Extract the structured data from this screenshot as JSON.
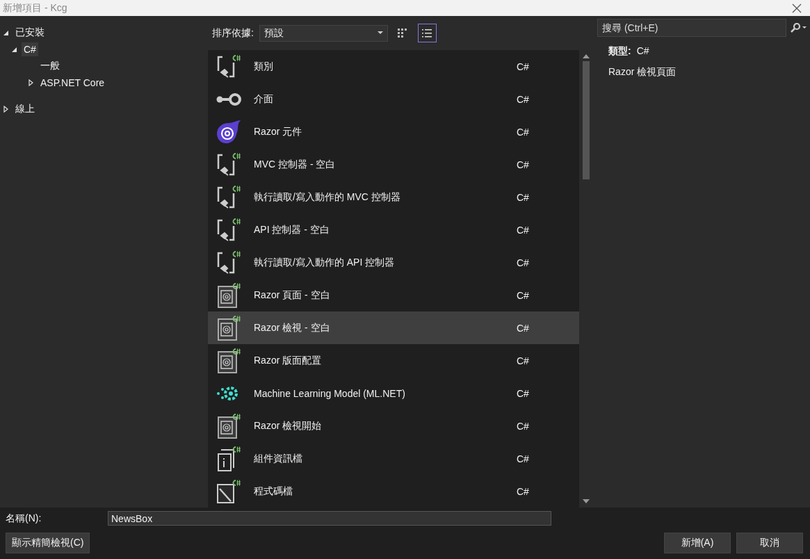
{
  "window": {
    "title": "新增項目 - Kcg"
  },
  "tree": [
    {
      "label": "已安裝",
      "expanded": true,
      "selected": false,
      "children": [
        {
          "label": "C#",
          "expanded": true,
          "selected": true,
          "children": [
            {
              "label": "一般",
              "selected": false
            },
            {
              "label": "ASP.NET Core",
              "expanded": false,
              "selected": false
            }
          ]
        }
      ]
    },
    {
      "label": "線上",
      "expanded": false,
      "selected": false
    }
  ],
  "sort": {
    "label": "排序依據:",
    "value": "預設"
  },
  "view_toggles": [
    {
      "kind": "grid",
      "selected": false
    },
    {
      "kind": "list",
      "selected": true
    }
  ],
  "search": {
    "placeholder": "搜尋 (Ctrl+E)"
  },
  "templates": [
    {
      "kind": "class",
      "name": "類別",
      "language": "C#",
      "selected": false
    },
    {
      "kind": "interface",
      "name": "介面",
      "language": "C#",
      "selected": false
    },
    {
      "kind": "component",
      "name": "Razor 元件",
      "language": "C#",
      "selected": false
    },
    {
      "kind": "class",
      "name": "MVC 控制器 - 空白",
      "language": "C#",
      "selected": false
    },
    {
      "kind": "class",
      "name": "執行讀取/寫入動作的 MVC 控制器",
      "language": "C#",
      "selected": false
    },
    {
      "kind": "class",
      "name": "API 控制器 - 空白",
      "language": "C#",
      "selected": false
    },
    {
      "kind": "class",
      "name": "執行讀取/寫入動作的 API 控制器",
      "language": "C#",
      "selected": false
    },
    {
      "kind": "razor",
      "name": "Razor 頁面 - 空白",
      "language": "C#",
      "selected": false
    },
    {
      "kind": "razor",
      "name": "Razor 檢視 - 空白",
      "language": "C#",
      "selected": true
    },
    {
      "kind": "razor",
      "name": "Razor 版面配置",
      "language": "C#",
      "selected": false
    },
    {
      "kind": "ml",
      "name": "Machine Learning Model (ML.NET)",
      "language": "C#",
      "selected": false
    },
    {
      "kind": "razor",
      "name": "Razor 檢視開始",
      "language": "C#",
      "selected": false
    },
    {
      "kind": "info",
      "name": "組件資訊檔",
      "language": "C#",
      "selected": false
    },
    {
      "kind": "code",
      "name": "程式碼檔",
      "language": "C#",
      "selected": false
    }
  ],
  "details": {
    "type_label": "類型:",
    "type_value": "C#",
    "description": "Razor 檢視頁面"
  },
  "name_field": {
    "label": "名稱(N):",
    "value": "NewsBox"
  },
  "buttons": {
    "compact": "顯示精簡檢視(C)",
    "add": "新增(A)",
    "cancel": "取消"
  }
}
